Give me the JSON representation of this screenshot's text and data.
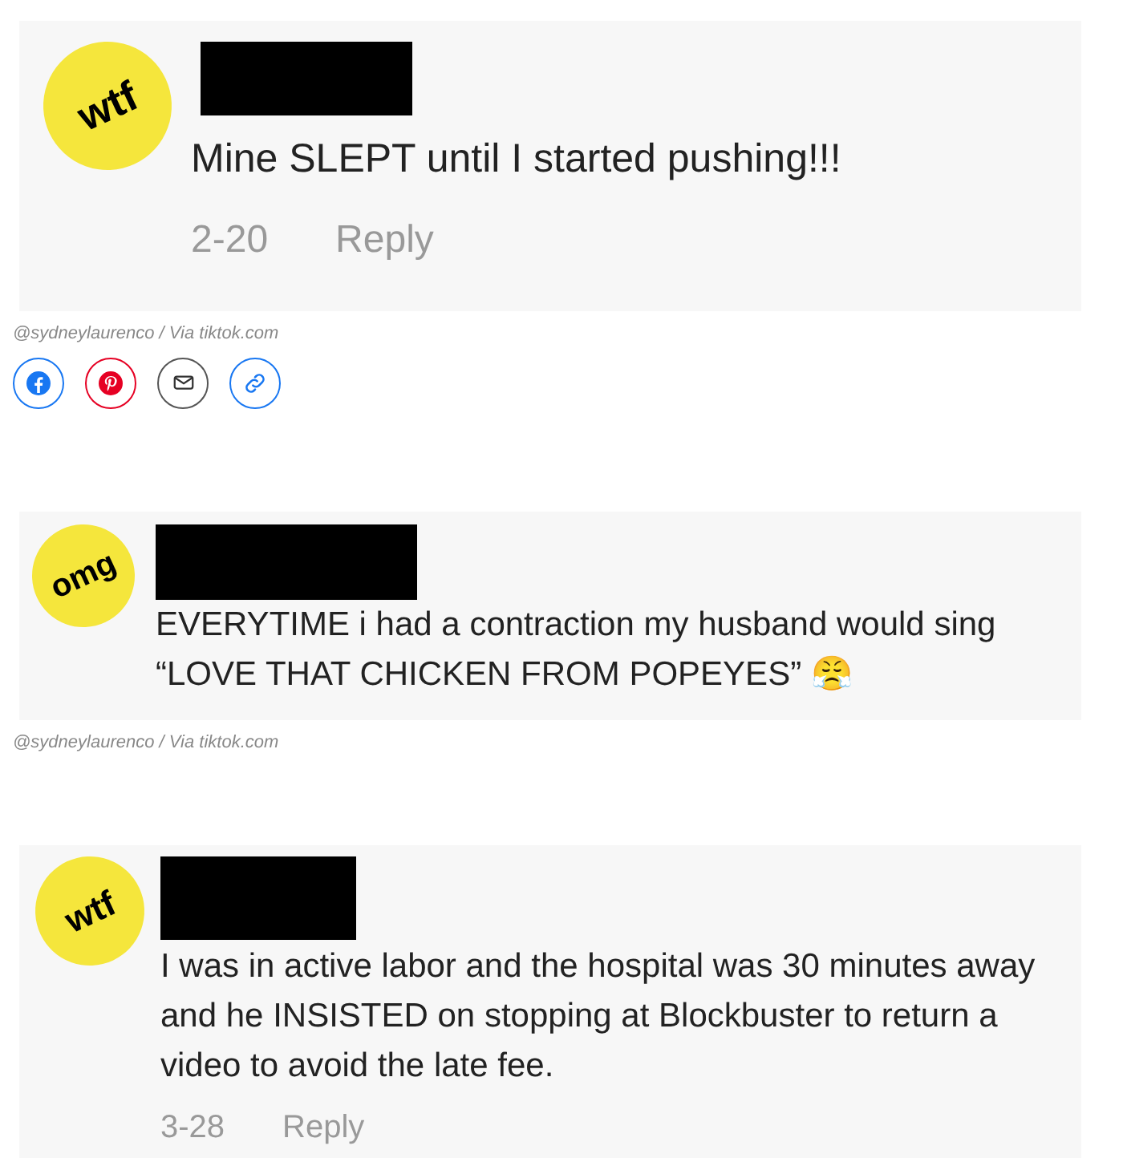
{
  "posts": [
    {
      "kind": "large",
      "badge": "wtf",
      "comment": "Mine SLEPT until I started pushing!!!",
      "date": "2-20",
      "reply": "Reply",
      "credit": "@sydneylaurenco / Via tiktok.com",
      "share_buttons": [
        {
          "kind": "facebook"
        },
        {
          "kind": "pinterest"
        },
        {
          "kind": "email"
        },
        {
          "kind": "link"
        }
      ]
    },
    {
      "kind": "medium",
      "badge": "omg",
      "comment": "EVERYTIME i had a contraction my husband would sing “LOVE THAT CHICKEN FROM POPEYES” 😤",
      "credit": "@sydneylaurenco / Via tiktok.com"
    },
    {
      "kind": "small",
      "badge": "wtf",
      "comment": "I was in active labor and the hospital was 30 minutes away and he INSISTED on stopping at Blockbuster to return a video to avoid the late fee.",
      "date": "3-28",
      "reply": "Reply"
    }
  ]
}
